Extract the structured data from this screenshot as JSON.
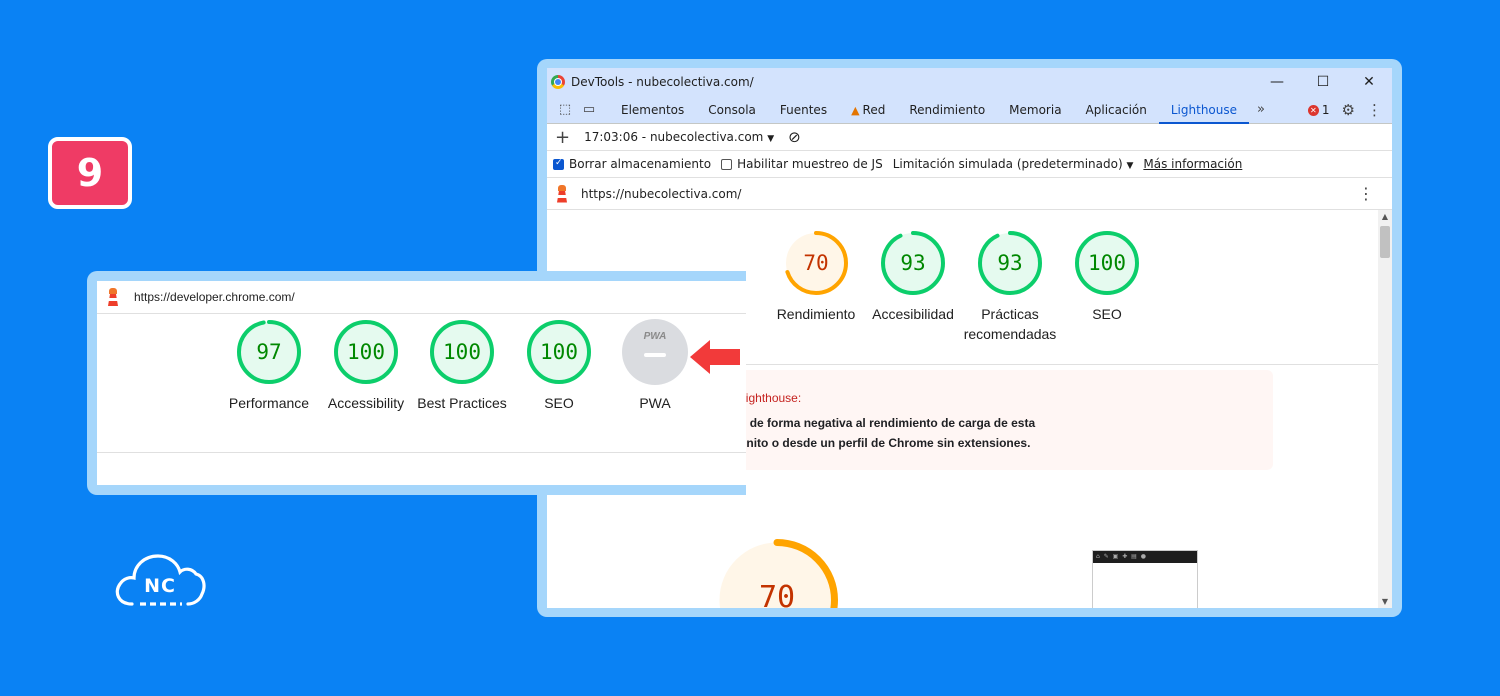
{
  "badge": {
    "number": "9"
  },
  "logo": {
    "text": "NC"
  },
  "devtools": {
    "window_title": "DevTools - nubecolectiva.com/",
    "window_controls": [
      "—",
      "☐",
      "✕"
    ],
    "tabs": [
      {
        "label": "Elementos"
      },
      {
        "label": "Consola"
      },
      {
        "label": "Fuentes"
      },
      {
        "label": "Red",
        "warning": true
      },
      {
        "label": "Rendimiento"
      },
      {
        "label": "Memoria"
      },
      {
        "label": "Aplicación"
      },
      {
        "label": "Lighthouse",
        "active": true
      }
    ],
    "more_tabs": "»",
    "error_count": "1",
    "report_selector": "17:03:06 - nubecolectiva.com",
    "options": {
      "clear_storage": "Borrar almacenamiento",
      "js_sampling": "Habilitar muestreo de JS",
      "throttling": "Limitación simulada (predeterminado)",
      "more_info": "Más información"
    },
    "url": "https://nubecolectiva.com/",
    "scores": [
      {
        "value": "70",
        "label": "Rendimiento",
        "score": 70,
        "status": "average"
      },
      {
        "value": "93",
        "label": "Accesibilidad",
        "score": 93,
        "status": "pass"
      },
      {
        "value": "93",
        "label": "Prácticas recomendadas",
        "score": 93,
        "status": "pass"
      },
      {
        "value": "100",
        "label": "SEO",
        "score": 100,
        "status": "pass"
      }
    ],
    "warning": {
      "heading": "mas han afectado a la ejecución de Lighthouse:",
      "line1": "tensiones de Chrome han afectado de forma negativa al rendimiento de carga de esta",
      "line2": ". Prueba a auditarla en modo incógnito o desde un perfil de Chrome sin extensiones."
    },
    "big_score": {
      "value": "70",
      "score": 70
    }
  },
  "overlay": {
    "url": "https://developer.chrome.com/",
    "scores": [
      {
        "value": "97",
        "label": "Performance",
        "score": 97
      },
      {
        "value": "100",
        "label": "Accessibility",
        "score": 100
      },
      {
        "value": "100",
        "label": "Best Practices",
        "score": 100
      },
      {
        "value": "100",
        "label": "SEO",
        "score": 100
      }
    ],
    "pwa": {
      "badge_text": "PWA",
      "label": "PWA"
    }
  },
  "colors": {
    "background": "#0a82f4",
    "badge": "#ef3b65",
    "pass": "#0cce6b",
    "pass_fill": "#e5faef",
    "pass_text": "#008800",
    "average": "#ffa400",
    "average_fill": "#fff6e8",
    "average_text": "#c33300",
    "arrow": "#f23a3a"
  },
  "icons": [
    "chrome-icon",
    "inspect-icon",
    "device-toggle-icon",
    "warning-icon",
    "error-icon",
    "settings-icon",
    "kebab-icon",
    "plus-icon",
    "clear-icon",
    "lighthouse-icon",
    "cloud-logo",
    "arrow-left-icon"
  ]
}
